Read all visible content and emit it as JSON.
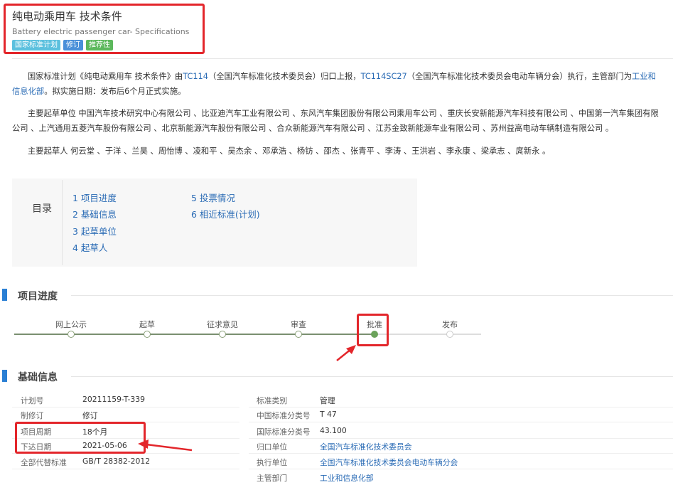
{
  "header": {
    "title_cn": "纯电动乘用车 技术条件",
    "title_en": "Battery electric passenger car- Specifications",
    "badges": [
      {
        "label": "国家标准计划",
        "color": "#5bc0de"
      },
      {
        "label": "修订",
        "color": "#4a90d9"
      },
      {
        "label": "推荐性",
        "color": "#5cb85c"
      }
    ]
  },
  "intro": {
    "p1_a": "国家标准计划《纯电动乘用车 技术条件》由",
    "p1_link1": "TC114",
    "p1_b": "（全国汽车标准化技术委员会）归口上报，",
    "p1_link2": "TC114SC27",
    "p1_c": "（全国汽车标准化技术委员会电动车辆分会）执行，主管部门为",
    "p1_link3": "工业和信息化部",
    "p1_d": "。拟实施日期：发布后6个月正式实施。",
    "p2": "主要起草单位 中国汽车技术研究中心有限公司 、比亚迪汽车工业有限公司 、东风汽车集团股份有限公司乘用车公司 、重庆长安新能源汽车科技有限公司 、中国第一汽车集团有限公司 、上汽通用五菱汽车股份有限公司 、北京新能源汽车股份有限公司 、合众新能源汽车有限公司 、江苏金致新能源车业有限公司 、苏州益高电动车辆制造有限公司 。",
    "p3": "主要起草人 何云堂 、于洋 、兰昊 、周怡博 、凌和平 、吴杰余 、邓承浩 、杨钫 、邵杰 、张青平 、李涛 、王洪岩 、李永康 、梁承志 、庹新永 。"
  },
  "toc": {
    "heading": "目录",
    "items": [
      "1  项目进度",
      "2  基础信息",
      "3  起草单位",
      "4  起草人",
      "5  投票情况",
      "6  相近标准(计划)"
    ]
  },
  "progress": {
    "title": "项目进度",
    "steps": [
      {
        "label": "网上公示",
        "state": "done"
      },
      {
        "label": "起草",
        "state": "done"
      },
      {
        "label": "征求意见",
        "state": "done"
      },
      {
        "label": "审查",
        "state": "done"
      },
      {
        "label": "批准",
        "state": "current"
      },
      {
        "label": "发布",
        "state": "pending"
      }
    ]
  },
  "basic": {
    "title": "基础信息",
    "left": [
      {
        "label": "计划号",
        "value": "20211159-T-339"
      },
      {
        "label": "制修订",
        "value": "修订"
      },
      {
        "label": "项目周期",
        "value": "18个月"
      },
      {
        "label": "下达日期",
        "value": "2021-05-06"
      },
      {
        "label": "全部代替标准",
        "value": "GB/T 28382-2012"
      }
    ],
    "right": [
      {
        "label": "标准类别",
        "value": "管理"
      },
      {
        "label": "中国标准分类号",
        "value": "T 47"
      },
      {
        "label": "国际标准分类号",
        "value": "43.100"
      },
      {
        "label": "归口单位",
        "value": "全国汽车标准化技术委员会"
      },
      {
        "label": "执行单位",
        "value": "全国汽车标准化技术委员会电动车辆分会"
      },
      {
        "label": "主管部门",
        "value": "工业和信息化部"
      }
    ]
  },
  "colors": {
    "accent_blue": "#2a7fd4",
    "link": "#2a6bb5",
    "highlight_red": "#e3262b",
    "progress_green": "#6ba25a"
  }
}
